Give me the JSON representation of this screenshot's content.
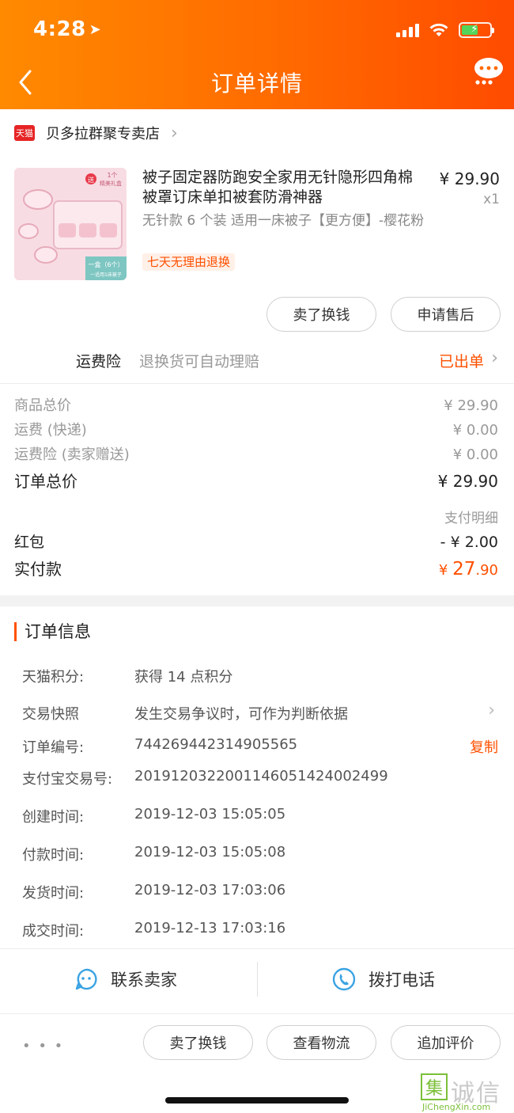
{
  "status_bar": {
    "time": "4:28"
  },
  "header": {
    "title": "订单详情"
  },
  "shop": {
    "badge": "天猫",
    "name": "贝多拉群聚专卖店"
  },
  "product": {
    "title": "被子固定器防跑安全家用无针隐形四角棉被罩订床单扣被套防滑神器",
    "spec": "无针款 6 个装 适用一床被子【更方便】-樱花粉",
    "badge": "七天无理由退换",
    "price": "¥ 29.90",
    "qty": "x1",
    "img_texts": {
      "gift": "送",
      "gift_line1": "1个",
      "gift_line2": "精美礼盒",
      "box": "一盒（6个）",
      "box_sub": "一适用1床被子"
    }
  },
  "product_actions": {
    "sell": "卖了换钱",
    "after_sale": "申请售后"
  },
  "insurance": {
    "label": "运费险",
    "desc": "退换货可自动理赔",
    "status": "已出单"
  },
  "prices": {
    "goods_label": "商品总价",
    "goods_value": "¥ 29.90",
    "shipping_label": "运费 (快递)",
    "shipping_value": "¥ 0.00",
    "ins_label": "运费险 (卖家赠送)",
    "ins_value": "¥ 0.00",
    "total_label": "订单总价",
    "total_value": "¥ 29.90",
    "detail_link": "支付明细",
    "redpack_label": "红包",
    "redpack_value": "- ¥ 2.00",
    "paid_label": "实付款",
    "paid_currency": "¥",
    "paid_int": "27",
    "paid_dec": ".90"
  },
  "order_info": {
    "title": "订单信息",
    "rows": [
      {
        "label": "天猫积分:",
        "value": "获得 14 点积分"
      },
      {
        "label": "交易快照",
        "value": "发生交易争议时，可作为判断依据"
      },
      {
        "label": "订单编号:",
        "value": "744269442314905565",
        "action": "复制"
      },
      {
        "label": "支付宝交易号:",
        "value": "2019120322001146051424002499"
      },
      {
        "label": "创建时间:",
        "value": "2019-12-03 15:05:05"
      },
      {
        "label": "付款时间:",
        "value": "2019-12-03 15:05:08"
      },
      {
        "label": "发货时间:",
        "value": "2019-12-03 17:03:06"
      },
      {
        "label": "成交时间:",
        "value": "2019-12-13 17:03:16"
      }
    ]
  },
  "contact": {
    "seller": "联系卖家",
    "phone": "拨打电话"
  },
  "bottom_actions": {
    "more": "• • •",
    "sell": "卖了换钱",
    "logistics": "查看物流",
    "review": "追加评价"
  },
  "watermark": {
    "box": "集",
    "text": "诚信",
    "url": "JiChengXin.com"
  },
  "colors": {
    "accent": "#ff5000",
    "header_start": "#ff8a00",
    "header_end": "#ff4b00"
  }
}
